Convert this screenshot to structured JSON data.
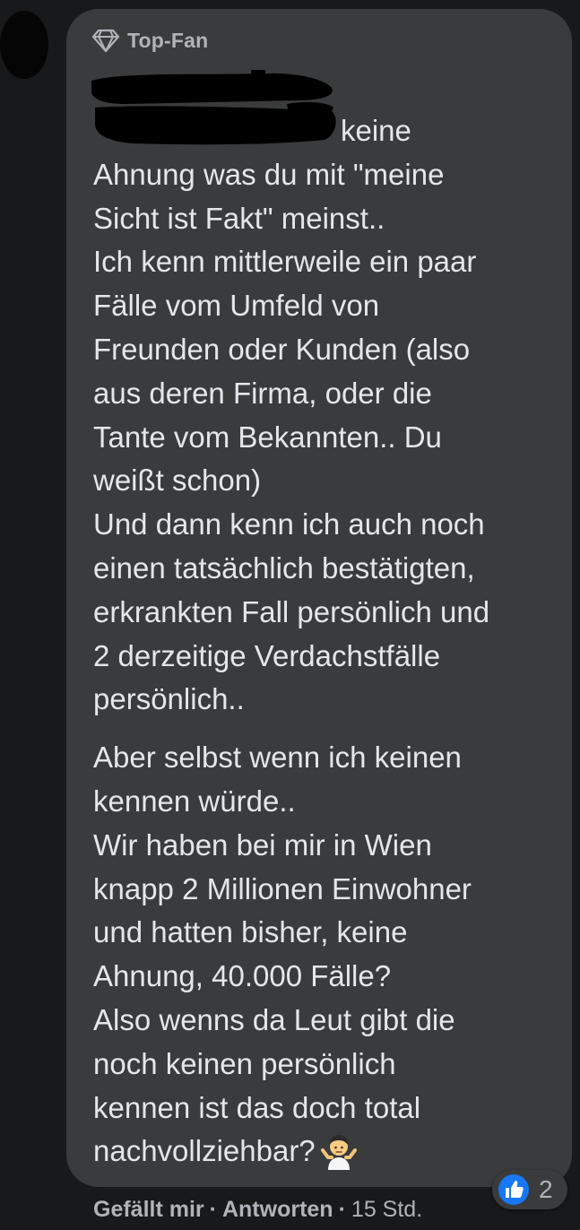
{
  "comment": {
    "badge_label": "Top-Fan",
    "badge_icon": "diamond-icon",
    "paragraphs": [
      {
        "lines": [
          "keine",
          "Ahnung was du mit \"meine",
          "Sicht ist Fakt\" meinst..",
          "Ich kenn mittlerweile ein paar",
          "Fälle vom Umfeld von",
          "Freunden oder Kunden (also",
          "aus deren Firma, oder die",
          "Tante vom Bekannten.. Du",
          "weißt schon)",
          "Und dann kenn ich auch noch",
          "einen tatsächlich bestätigten,",
          "erkrankten Fall persönlich und",
          "2 derzeitige Verdachstfälle",
          "persönlich.."
        ]
      },
      {
        "lines": [
          "Aber selbst wenn ich keinen",
          "kennen würde..",
          "Wir haben bei mir in Wien",
          "knapp 2 Millionen Einwohner",
          "und hatten bisher, keine",
          "Ahnung, 40.000 Fälle?",
          "Also wenns da Leut gibt die",
          "noch keinen persönlich",
          "kennen ist das doch total",
          "nachvollziehbar?"
        ]
      }
    ],
    "trailing_emoji": "person-shrugging-emoji"
  },
  "reactions": {
    "icon": "like-icon",
    "count": "2"
  },
  "actions": {
    "like_label": "Gefällt mir",
    "separator": "·",
    "reply_label": "Antworten",
    "timestamp": "15 Std."
  },
  "colors": {
    "page_background": "#18191a",
    "bubble_background": "#3a3b3c",
    "primary_text": "#e4e6eb",
    "secondary_text": "#b0b3b8",
    "like_blue": "#1877f2"
  }
}
